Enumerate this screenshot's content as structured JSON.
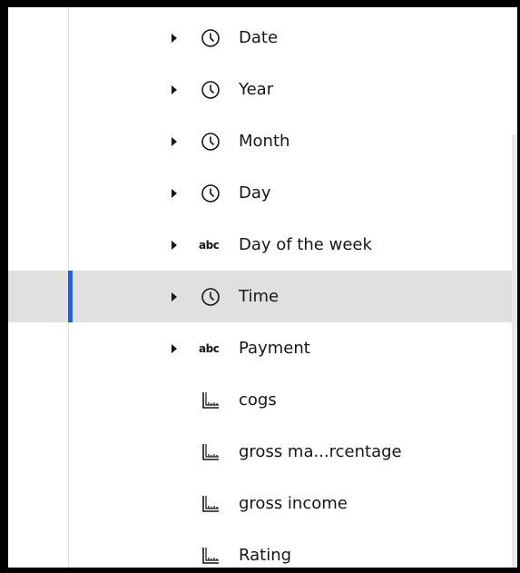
{
  "tree": {
    "items": [
      {
        "label": "Date",
        "icon": "clock-icon",
        "expandable": true,
        "selected": false
      },
      {
        "label": "Year",
        "icon": "clock-icon",
        "expandable": true,
        "selected": false
      },
      {
        "label": "Month",
        "icon": "clock-icon",
        "expandable": true,
        "selected": false
      },
      {
        "label": "Day",
        "icon": "clock-icon",
        "expandable": true,
        "selected": false
      },
      {
        "label": "Day of the week",
        "icon": "abc-icon",
        "icon_text": "abc",
        "expandable": true,
        "selected": false
      },
      {
        "label": "Time",
        "icon": "clock-icon",
        "expandable": true,
        "selected": true
      },
      {
        "label": "Payment",
        "icon": "abc-icon",
        "icon_text": "abc",
        "expandable": true,
        "selected": false
      },
      {
        "label": "cogs",
        "icon": "ruler-icon",
        "expandable": false,
        "selected": false
      },
      {
        "label": "gross ma...rcentage",
        "icon": "ruler-icon",
        "expandable": false,
        "selected": false
      },
      {
        "label": "gross income",
        "icon": "ruler-icon",
        "expandable": false,
        "selected": false
      },
      {
        "label": "Rating",
        "icon": "ruler-icon",
        "expandable": false,
        "selected": false
      }
    ]
  },
  "colors": {
    "selected_accent": "#0f62fe",
    "selected_background": "#e0e0e0",
    "text": "#161616"
  }
}
